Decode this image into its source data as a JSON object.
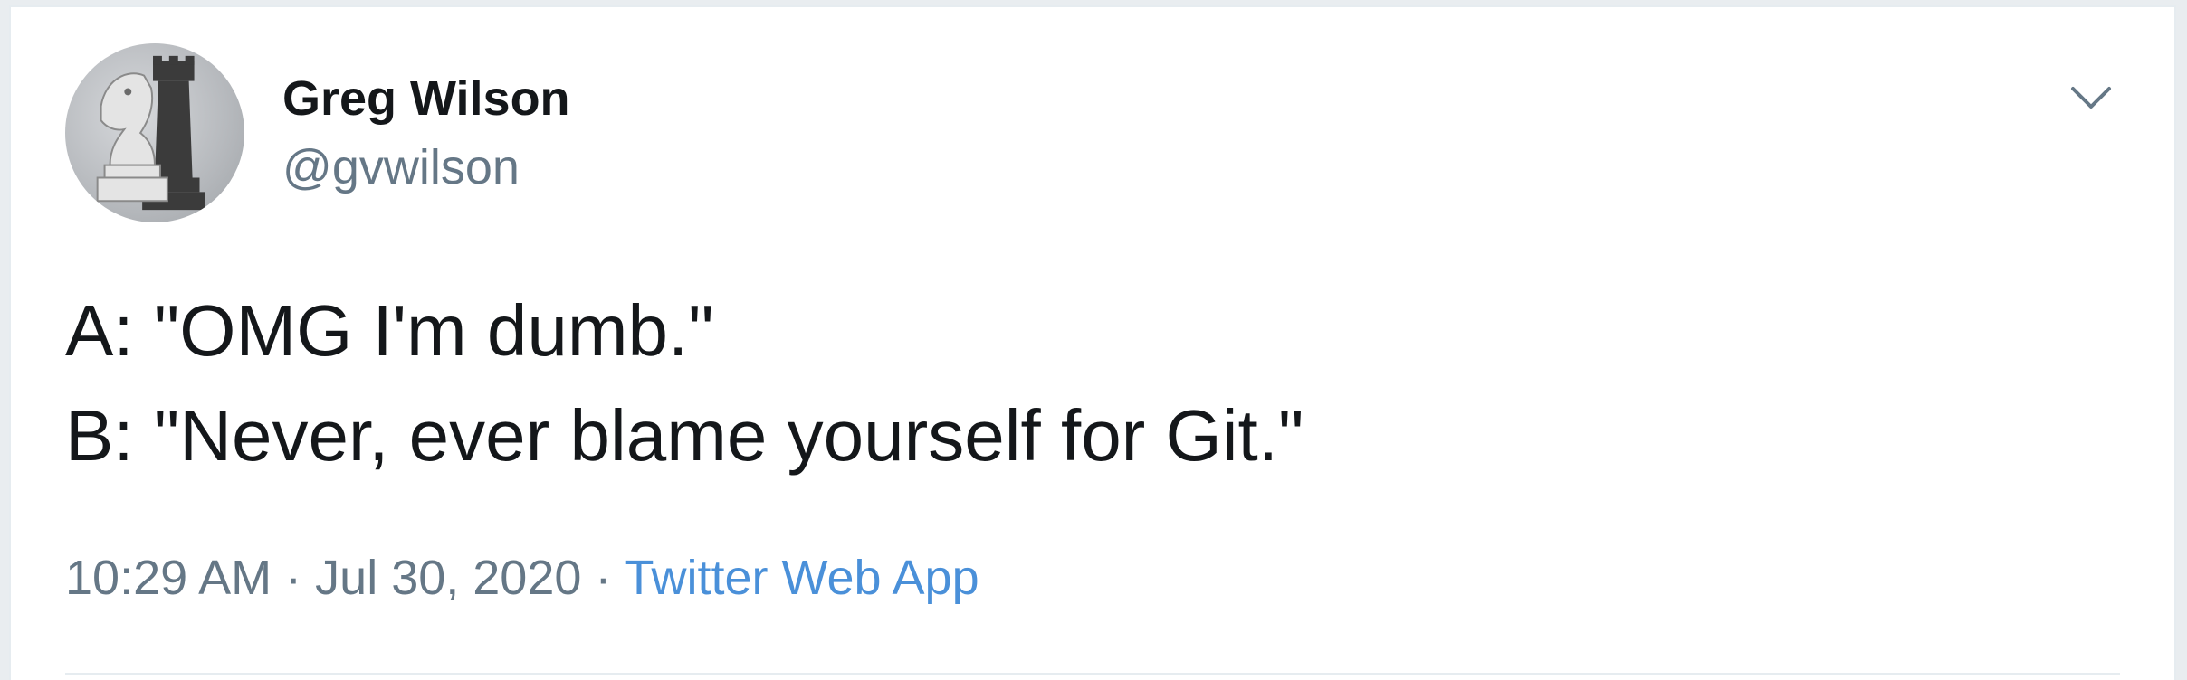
{
  "author": {
    "display_name": "Greg Wilson",
    "handle": "@gvwilson",
    "avatar_icon": "chess-pieces-avatar"
  },
  "tweet": {
    "lines": [
      "A: \"OMG I'm dumb.\"",
      "B: \"Never, ever blame yourself for Git.\""
    ],
    "time": "10:29 AM",
    "separator": "·",
    "date": "Jul 30, 2020",
    "source": "Twitter Web App"
  },
  "colors": {
    "text": "#14171a",
    "secondary": "#657786",
    "link": "#4a90d9",
    "divider": "#e6ecf0"
  }
}
